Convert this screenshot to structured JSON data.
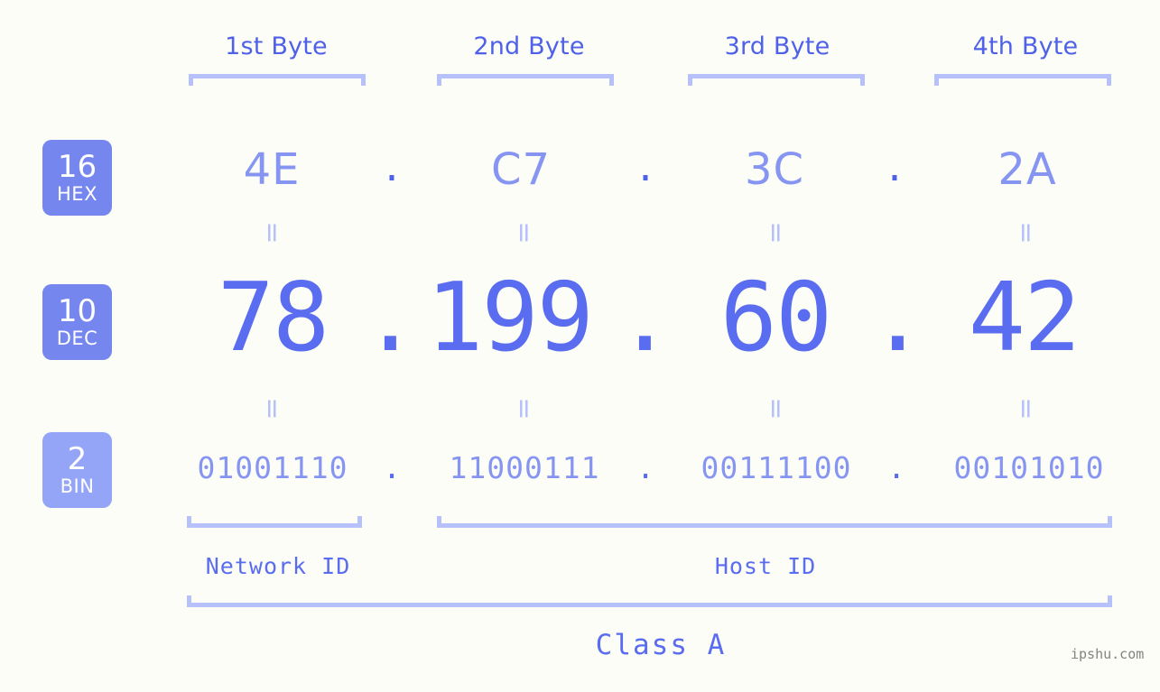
{
  "colors": {
    "background": "#fbfdf6",
    "accent_strong": "#4f61e8",
    "accent_mid": "#5a6cef",
    "accent_light": "#8795f2",
    "accent_pale": "#b6c0fb",
    "badge_fill": "#7586ef",
    "badge_fill_light": "#94a4f7",
    "watermark": "#838383"
  },
  "byte_headers": [
    {
      "label": "1st Byte"
    },
    {
      "label": "2nd Byte"
    },
    {
      "label": "3rd Byte"
    },
    {
      "label": "4th Byte"
    }
  ],
  "radix_badges": [
    {
      "number": "16",
      "name": "HEX"
    },
    {
      "number": "10",
      "name": "DEC"
    },
    {
      "number": "2",
      "name": "BIN"
    }
  ],
  "rows": {
    "hex": {
      "values": [
        "4E",
        "C7",
        "3C",
        "2A"
      ],
      "separator": "."
    },
    "dec": {
      "values": [
        "78",
        "199",
        "60",
        "42"
      ],
      "separator": "."
    },
    "bin": {
      "values": [
        "01001110",
        "11000111",
        "00111100",
        "00101010"
      ],
      "separator": "."
    }
  },
  "equals_marks": {
    "glyph": "=",
    "count_per_row": 4
  },
  "id_sections": [
    {
      "label": "Network ID"
    },
    {
      "label": "Host ID"
    }
  ],
  "class_label": "Class A",
  "watermark": "ipshu.com"
}
